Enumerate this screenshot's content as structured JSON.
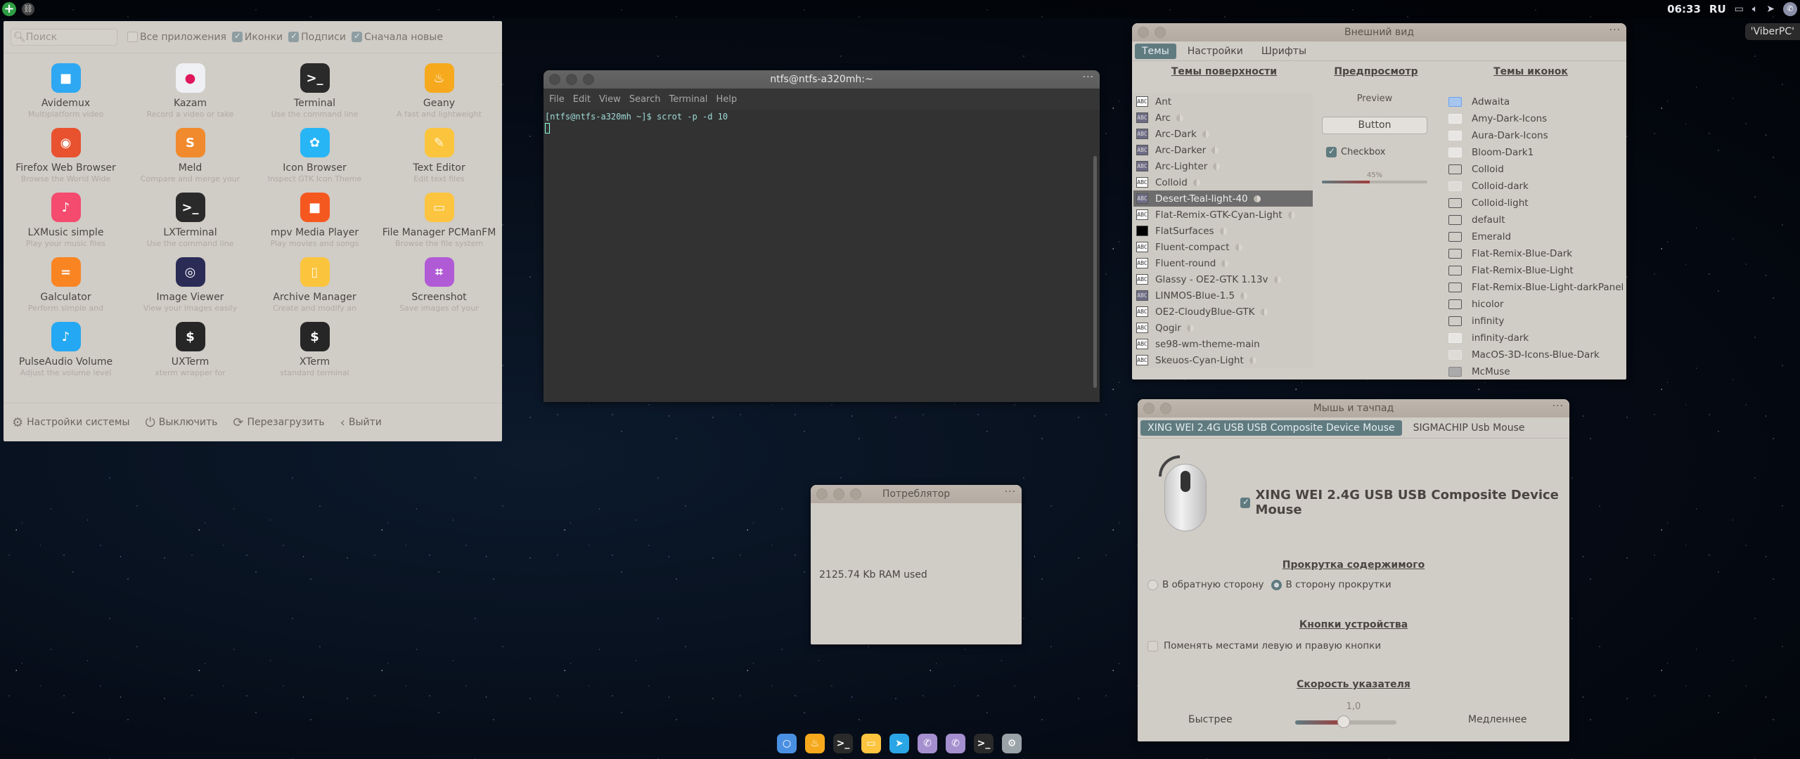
{
  "top_panel": {
    "left_icons": [
      "add-icon",
      "link-icon"
    ],
    "clock": "06:33",
    "lang": "RU",
    "tray_icons": [
      "chat-icon",
      "volume-icon",
      "telegram-icon",
      "viber-icon"
    ],
    "tooltip": "'ViberPC'"
  },
  "menu": {
    "search_placeholder": "Поиск",
    "filters": [
      {
        "label": "Все приложения",
        "checked": false
      },
      {
        "label": "Иконки",
        "checked": true
      },
      {
        "label": "Подписи",
        "checked": true
      },
      {
        "label": "Сначала новые",
        "checked": true
      }
    ],
    "apps": [
      {
        "name": "Avidemux",
        "desc": "Multiplatform video",
        "icon": "video-camera-icon",
        "color": "#2ea8f2",
        "glyph": "■"
      },
      {
        "name": "Kazam",
        "desc": "Record a video or take",
        "icon": "camera-icon",
        "color": "#eef0f3",
        "glyph": "●"
      },
      {
        "name": "Terminal",
        "desc": "Use the command line",
        "icon": "terminal-icon",
        "color": "#2a2a2a",
        "glyph": ">_"
      },
      {
        "name": "Geany",
        "desc": "A fast and lightweight",
        "icon": "lamp-icon",
        "color": "#f6a91c",
        "glyph": "♨"
      },
      {
        "name": "Firefox Web Browser",
        "desc": "Browse the World Wide",
        "icon": "firefox-icon",
        "color": "#e8522f",
        "glyph": "◉"
      },
      {
        "name": "Meld",
        "desc": "Compare and merge your",
        "icon": "meld-icon",
        "color": "#f08a2c",
        "glyph": "S"
      },
      {
        "name": "Icon Browser",
        "desc": "Inspect GTK Icon Theme",
        "icon": "gnome-foot-icon",
        "color": "#27b5f5",
        "glyph": "✿"
      },
      {
        "name": "Text Editor",
        "desc": "Edit text files",
        "icon": "text-editor-icon",
        "color": "#fbc43d",
        "glyph": "✎"
      },
      {
        "name": "LXMusic simple",
        "desc": "Play your music files",
        "icon": "music-note-icon",
        "color": "#f44b6e",
        "glyph": "♪"
      },
      {
        "name": "LXTerminal",
        "desc": "Use the command line",
        "icon": "terminal-icon",
        "color": "#2a2a2a",
        "glyph": ">_"
      },
      {
        "name": "mpv Media Player",
        "desc": "Play movies and songs",
        "icon": "media-player-icon",
        "color": "#f5581f",
        "glyph": "■"
      },
      {
        "name": "File Manager PCManFM",
        "desc": "Browse the file system",
        "icon": "folder-icon",
        "color": "#fcc43f",
        "glyph": "▭"
      },
      {
        "name": "Galculator",
        "desc": "Perform simple and",
        "icon": "calculator-icon",
        "color": "#f98422",
        "glyph": "="
      },
      {
        "name": "Image Viewer",
        "desc": "View your images easily",
        "icon": "image-viewer-icon",
        "color": "#2a2c56",
        "glyph": "◎"
      },
      {
        "name": "Archive Manager",
        "desc": "Create and modify an",
        "icon": "archive-icon",
        "color": "#fbc43d",
        "glyph": "▯"
      },
      {
        "name": "Screenshot",
        "desc": "Save images of your",
        "icon": "crop-icon",
        "color": "#b15ad6",
        "glyph": "⌗"
      },
      {
        "name": "PulseAudio Volume",
        "desc": "Adjust the volume level",
        "icon": "music-note-icon",
        "color": "#25a8f3",
        "glyph": "♪"
      },
      {
        "name": "UXTerm",
        "desc": "xterm wrapper for",
        "icon": "xterm-icon",
        "color": "#262626",
        "glyph": "$"
      },
      {
        "name": "XTerm",
        "desc": "standard terminal",
        "icon": "xterm-icon",
        "color": "#262626",
        "glyph": "$"
      }
    ],
    "bottom": [
      {
        "label": "Настройки системы",
        "icon": "gear-icon",
        "glyph": "⚙"
      },
      {
        "label": "Выключить",
        "icon": "power-icon",
        "glyph": "⏻"
      },
      {
        "label": "Перезагрузить",
        "icon": "reload-icon",
        "glyph": "⟳"
      },
      {
        "label": "Выйти",
        "icon": "logout-icon",
        "glyph": "‹"
      }
    ]
  },
  "terminal": {
    "title": "ntfs@ntfs-a320mh:~",
    "menu": [
      "File",
      "Edit",
      "View",
      "Search",
      "Terminal",
      "Help"
    ],
    "line1": "[ntfs@ntfs-a320mh ~]$ scrot -p -d 10"
  },
  "appearance": {
    "title": "Внешний вид",
    "tabs": [
      "Темы",
      "Настройки",
      "Шрифты"
    ],
    "active_tab": 0,
    "col_surface": "Темы поверхности",
    "col_preview": "Предпросмотр",
    "col_icons": "Темы иконок",
    "themes": [
      {
        "name": "Ant",
        "style": "light",
        "half": false
      },
      {
        "name": "Arc",
        "style": "dark",
        "half": true
      },
      {
        "name": "Arc-Dark",
        "style": "dark",
        "half": true
      },
      {
        "name": "Arc-Darker",
        "style": "dark",
        "half": true
      },
      {
        "name": "Arc-Lighter",
        "style": "dark",
        "half": true
      },
      {
        "name": "Colloid",
        "style": "light",
        "half": true
      },
      {
        "name": "Desert-Teal-light-40",
        "style": "dark",
        "half": true,
        "selected": true
      },
      {
        "name": "Flat-Remix-GTK-Cyan-Light",
        "style": "light",
        "half": true
      },
      {
        "name": "FlatSurfaces",
        "style": "black",
        "half": true
      },
      {
        "name": "Fluent-compact",
        "style": "light",
        "half": true
      },
      {
        "name": "Fluent-round",
        "style": "light",
        "half": true
      },
      {
        "name": "Glassy - OE2-GTK 1.13v",
        "style": "light",
        "half": true
      },
      {
        "name": "LINMOS-Blue-1.5",
        "style": "dark",
        "half": true
      },
      {
        "name": "OE2-CloudyBlue-GTK",
        "style": "light",
        "half": true
      },
      {
        "name": "Qogir",
        "style": "light",
        "half": true
      },
      {
        "name": "se98-wm-theme-main",
        "style": "light",
        "half": false
      },
      {
        "name": "Skeuos-Cyan-Light",
        "style": "light",
        "half": true
      }
    ],
    "preview": {
      "label": "Preview",
      "button": "Button",
      "checkbox": "Checkbox",
      "checkbox_checked": true,
      "progress_text": "45%",
      "progress": 0.45
    },
    "icon_themes": [
      {
        "name": "Adwaita",
        "style": "blue"
      },
      {
        "name": "Amy-Dark-Icons",
        "style": "white"
      },
      {
        "name": "Aura-Dark-Icons",
        "style": "white"
      },
      {
        "name": "Bloom-Dark1",
        "style": "white"
      },
      {
        "name": "Colloid",
        "style": "dark"
      },
      {
        "name": "Colloid-dark",
        "style": "faint"
      },
      {
        "name": "Colloid-light",
        "style": "dark"
      },
      {
        "name": "default",
        "style": "dark"
      },
      {
        "name": "Emerald",
        "style": "dark"
      },
      {
        "name": "Flat-Remix-Blue-Dark",
        "style": "dark"
      },
      {
        "name": "Flat-Remix-Blue-Light",
        "style": "dark"
      },
      {
        "name": "Flat-Remix-Blue-Light-darkPanel",
        "style": "dark"
      },
      {
        "name": "hicolor",
        "style": "dark"
      },
      {
        "name": "infinity",
        "style": "dark"
      },
      {
        "name": "infinity-dark",
        "style": "white"
      },
      {
        "name": "MacOS-3D-Icons-Blue-Dark",
        "style": "faint"
      },
      {
        "name": "McMuse",
        "style": "gray"
      }
    ]
  },
  "mouse": {
    "title": "Мышь и тачпад",
    "tabs": [
      "XING WEI 2.4G USB USB Composite Device Mouse",
      "SIGMACHIP Usb Mouse"
    ],
    "active_tab": 0,
    "device_label": "XING WEI 2.4G USB USB Composite Device Mouse",
    "device_enabled": true,
    "scroll_heading": "Прокрутка содержимого",
    "scroll_options": [
      {
        "label": "В обратную сторону",
        "selected": false
      },
      {
        "label": "В сторону прокрутки",
        "selected": true
      }
    ],
    "buttons_heading": "Кнопки устройства",
    "swap_label": "Поменять местами левую и правую кнопки",
    "swap_checked": false,
    "speed_heading": "Скорость указателя",
    "speed_value": "1,0",
    "speed_fraction": 0.48,
    "speed_fast": "Быстрее",
    "speed_slow": "Медленнее"
  },
  "consumer": {
    "title": "Потреблятор",
    "text": "2125.74 Kb RAM used"
  },
  "dock": [
    {
      "name": "chromium",
      "icon": "browser-icon",
      "color": "#4a90e2",
      "glyph": "○"
    },
    {
      "name": "geany",
      "icon": "lamp-icon",
      "color": "#f6a91c",
      "glyph": "♨"
    },
    {
      "name": "terminal",
      "icon": "terminal-icon",
      "color": "#2a2a2a",
      "glyph": ">_"
    },
    {
      "name": "files",
      "icon": "folder-icon",
      "color": "#fcc43f",
      "glyph": "▭"
    },
    {
      "name": "telegram",
      "icon": "telegram-icon",
      "color": "#2aa6e6",
      "glyph": "➤"
    },
    {
      "name": "viber",
      "icon": "viber-icon",
      "color": "#a58fcf",
      "glyph": "✆"
    },
    {
      "name": "viber2",
      "icon": "viber-icon",
      "color": "#a58fcf",
      "glyph": "✆"
    },
    {
      "name": "terminal2",
      "icon": "terminal-icon",
      "color": "#2a2a2a",
      "glyph": ">_"
    },
    {
      "name": "settings",
      "icon": "gear-icon",
      "color": "#9aa3a8",
      "glyph": "⚙"
    }
  ]
}
